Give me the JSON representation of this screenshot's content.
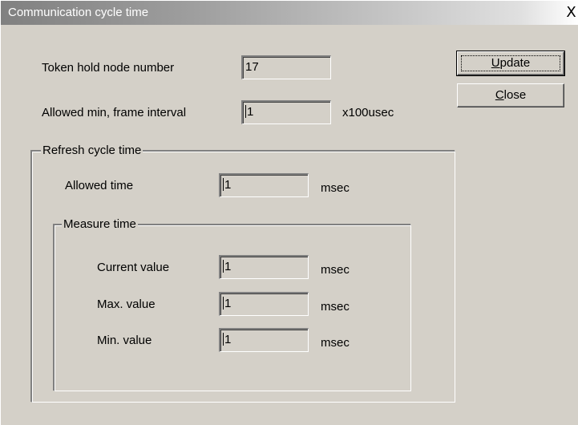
{
  "window": {
    "title": "Communication cycle time",
    "close_glyph": "X"
  },
  "token": {
    "label": "Token hold node number",
    "value": "17"
  },
  "frame": {
    "label": "Allowed min, frame interval",
    "value": "1",
    "unit": "x100usec"
  },
  "refresh": {
    "legend": "Refresh cycle time",
    "allowed_label": "Allowed time",
    "allowed_value": "1",
    "allowed_unit": "msec"
  },
  "measure": {
    "legend": "Measure time",
    "current_label": "Current value",
    "current_value": "1",
    "current_unit": "msec",
    "max_label": "Max. value",
    "max_value": "1",
    "max_unit": "msec",
    "min_label": "Min. value",
    "min_value": "1",
    "min_unit": "msec"
  },
  "buttons": {
    "update_mnemonic": "U",
    "update_rest": "pdate",
    "close_mnemonic": "C",
    "close_rest": "lose"
  }
}
